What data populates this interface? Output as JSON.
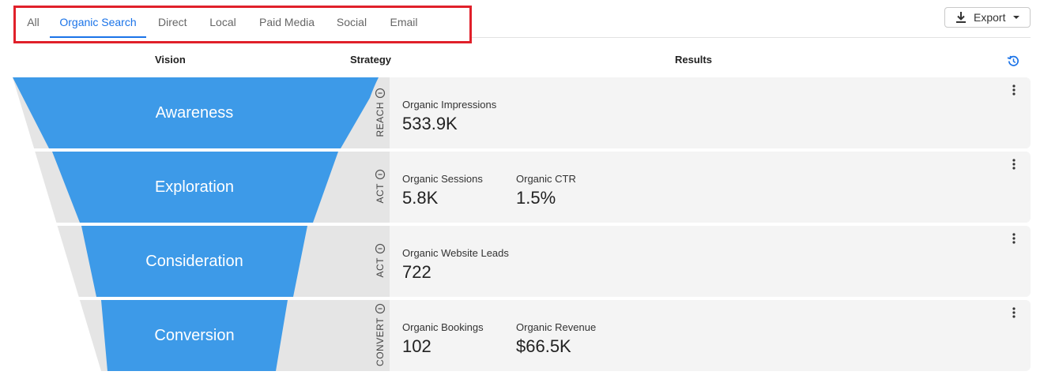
{
  "tabs": [
    {
      "label": "All",
      "active": false
    },
    {
      "label": "Organic Search",
      "active": true
    },
    {
      "label": "Direct",
      "active": false
    },
    {
      "label": "Local",
      "active": false
    },
    {
      "label": "Paid Media",
      "active": false
    },
    {
      "label": "Social",
      "active": false
    },
    {
      "label": "Email",
      "active": false
    }
  ],
  "export": {
    "label": "Export",
    "icon": "download-icon",
    "caret_icon": "caret-down-icon"
  },
  "headers": {
    "vision": "Vision",
    "strategy": "Strategy",
    "results": "Results",
    "history_icon": "history-icon"
  },
  "colors": {
    "funnel": "#3d9ae8",
    "strategy_bg": "#e5e5e5",
    "result_bg": "#f4f4f4",
    "accent": "#1a73e8",
    "highlight": "#e0202a"
  },
  "stages": [
    {
      "name": "Awareness",
      "strategy": "REACH",
      "metrics": [
        {
          "label": "Organic Impressions",
          "value": "533.9K"
        }
      ]
    },
    {
      "name": "Exploration",
      "strategy": "ACT",
      "metrics": [
        {
          "label": "Organic Sessions",
          "value": "5.8K"
        },
        {
          "label": "Organic CTR",
          "value": "1.5%"
        }
      ]
    },
    {
      "name": "Consideration",
      "strategy": "ACT",
      "metrics": [
        {
          "label": "Organic Website Leads",
          "value": "722"
        }
      ]
    },
    {
      "name": "Conversion",
      "strategy": "CONVERT",
      "metrics": [
        {
          "label": "Organic Bookings",
          "value": "102"
        },
        {
          "label": "Organic Revenue",
          "value": "$66.5K"
        }
      ]
    }
  ]
}
